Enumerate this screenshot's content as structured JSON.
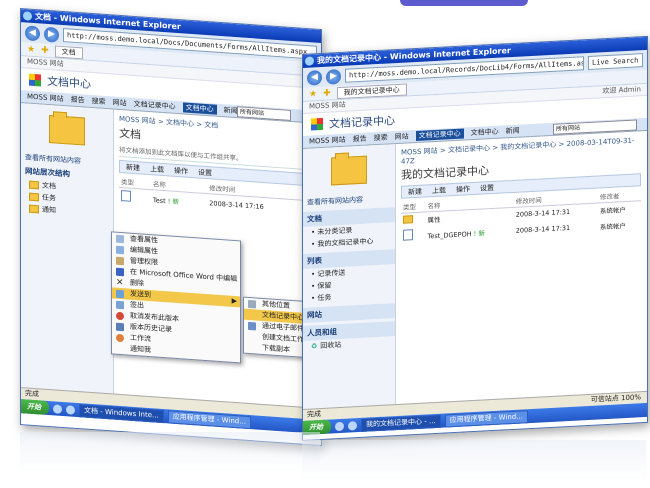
{
  "left_window": {
    "title": "文档 - Windows Internet Explorer",
    "url": "http://moss.demo.local/Docs/Documents/Forms/AllItems.aspx",
    "tab": "文档",
    "site_bar": "MOSS 网站",
    "site_title": "文档中心",
    "top_nav": [
      "MOSS 网站",
      "报告",
      "搜索",
      "网站",
      "文档记录中心",
      "文档中心",
      "新闻"
    ],
    "top_nav_selected": "文档中心",
    "search_scope": "所有网站",
    "left_nav": {
      "view_all": "查看所有网站内容",
      "hierarchy_header": "网站层次结构",
      "items": [
        "文档",
        "任务",
        "通知"
      ]
    },
    "breadcrumb": "MOSS 网站 > 文档中心 > 文档",
    "page_title": "文档",
    "description": "将文档添加到此文档库以便与工作组共享。",
    "toolbar": [
      "新建",
      "上载",
      "操作",
      "设置"
    ],
    "columns": [
      "类型",
      "名称",
      "修改时间"
    ],
    "rows": [
      {
        "name": "Test",
        "new_tag": "! 新",
        "modified": "2008-3-14 17:16"
      }
    ],
    "context_menu": [
      "查看属性",
      "编辑属性",
      "管理权限",
      "在 Microsoft Office Word 中编辑",
      "删除",
      "发送到",
      "签出",
      "取消发布此版本",
      "版本历史记录",
      "工作流",
      "通知我"
    ],
    "context_menu_highlight": "发送到",
    "submenu": [
      "其他位置",
      "文档记录中心",
      "通过电子邮件发送链接",
      "创建文档工作区",
      "下载副本"
    ],
    "status": "完成",
    "taskbar": {
      "start": "开始",
      "items": [
        "文档 - Windows Inte...",
        "应用程序管理 - Wind..."
      ]
    }
  },
  "right_window": {
    "title": "我的文档记录中心 - Windows Internet Explorer",
    "url": "http://moss.demo.local/Records/DocLib4/Forms/AllItems.aspx?RootF",
    "tab": "我的文档记录中心",
    "search_placeholder": "Live Search",
    "site_bar": "MOSS 网站",
    "welcome": "欢迎 Admin",
    "site_title": "文档记录中心",
    "top_nav": [
      "MOSS 网站",
      "报告",
      "搜索",
      "网站",
      "文档记录中心",
      "文档中心",
      "新闻"
    ],
    "top_nav_selected": "文档记录中心",
    "search_scope": "所有网站",
    "left_nav": {
      "view_all": "查看所有网站内容",
      "docs_header": "文档",
      "docs_items": [
        "未分类记录",
        "我的文档记录中心"
      ],
      "lists_header": "列表",
      "lists_items": [
        "记录传送",
        "保留",
        "任务"
      ],
      "sites_header": "网站",
      "people_header": "人员和组",
      "recycle": "回收站"
    },
    "breadcrumb": "MOSS 网站 > 文档记录中心 > 我的文档记录中心 > 2008-03-14T09-31-47Z",
    "page_title": "我的文档记录中心",
    "toolbar": [
      "新建",
      "上载",
      "操作",
      "设置"
    ],
    "columns": [
      "类型",
      "名称",
      "修改时间",
      "修改者"
    ],
    "rows": [
      {
        "name": "属性",
        "new_tag": "",
        "modified": "2008-3-14 17:31",
        "by": "系统帐户"
      },
      {
        "name": "Test_DGEPOH",
        "new_tag": "! 新",
        "modified": "2008-3-14 17:31",
        "by": "系统帐户"
      }
    ],
    "status": "完成",
    "zone": "可信站点",
    "zoom": "100%",
    "taskbar": {
      "start": "开始",
      "items": [
        "我的文档记录中心 - ...",
        "应用程序管理 - Wind..."
      ]
    }
  }
}
